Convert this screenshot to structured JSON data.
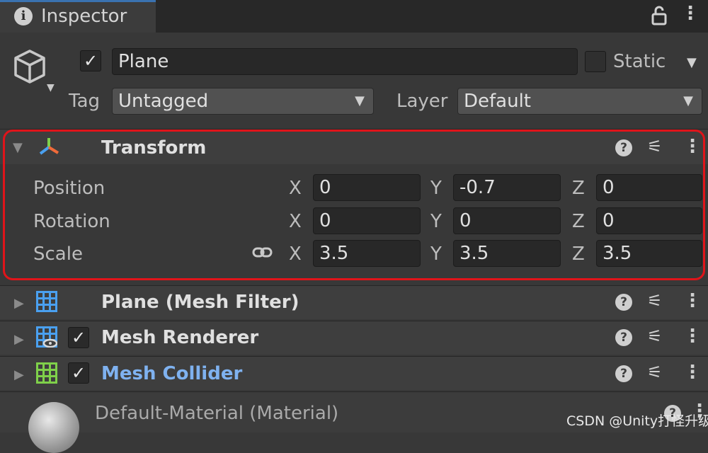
{
  "tab": {
    "title": "Inspector"
  },
  "header": {
    "name_value": "Plane",
    "active_checked": true,
    "static_label": "Static",
    "tag_label": "Tag",
    "tag_value": "Untagged",
    "layer_label": "Layer",
    "layer_value": "Default"
  },
  "transform": {
    "title": "Transform",
    "rows": [
      {
        "label": "Position",
        "x": "0",
        "y": "-0.7",
        "z": "0"
      },
      {
        "label": "Rotation",
        "x": "0",
        "y": "0",
        "z": "0"
      },
      {
        "label": "Scale",
        "x": "3.5",
        "y": "3.5",
        "z": "3.5"
      }
    ],
    "axis_x": "X",
    "axis_y": "Y",
    "axis_z": "Z"
  },
  "components": [
    {
      "title": "Plane (Mesh Filter)",
      "color": "#e0e0e0"
    },
    {
      "title": "Mesh Renderer",
      "color": "#e0e0e0"
    },
    {
      "title": "Mesh Collider",
      "color": "#7fb2f0"
    }
  ],
  "material": {
    "title": "Default-Material (Material)"
  },
  "watermark": "CSDN @Unity打怪升级",
  "colors": {
    "highlight": "#e0141a",
    "accent_link": "#7fb2f0",
    "tab_accent": "#3a72b0"
  }
}
